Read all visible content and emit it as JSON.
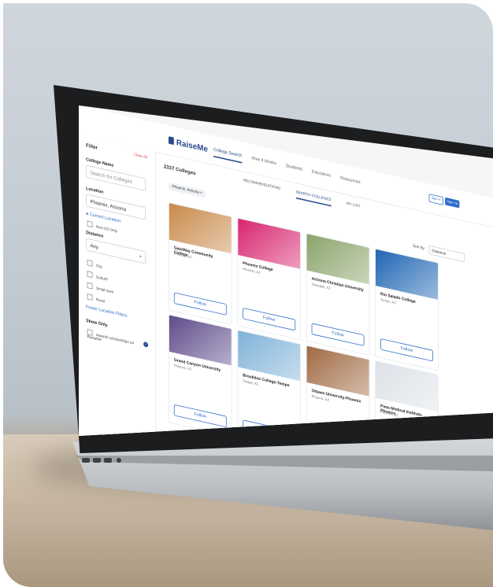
{
  "brand": {
    "name": "RaiseMe",
    "color": "#2a4b8d"
  },
  "nav": {
    "items": [
      "College Search",
      "How it Works",
      "Students",
      "Educators",
      "Resources"
    ],
    "signin": "Sign in",
    "signup": "Sign Up"
  },
  "sidebar": {
    "filter": "Filter",
    "clear": "Clear All",
    "college_name_label": "College Name",
    "college_name_placeholder": "Search for Colleges",
    "location_label": "Location",
    "location_value": "Phoenix, Arizona",
    "current_location": "Current Location",
    "non_us": "Non-US Only",
    "distance_label": "Distance",
    "distance_value": "Any",
    "types": [
      "City",
      "Suburb",
      "Small town",
      "Rural"
    ],
    "fewer": "Fewer Location Filters",
    "show_only": "Show Only",
    "awards": "Awards scholarships on RaiseMe"
  },
  "main": {
    "count": "2337 Colleges",
    "tabs": [
      "RECOMMENDATIONS",
      "SEARCH COLLEGES",
      "MY LIST"
    ],
    "chip": "Phoenix, Arizona ×",
    "sort_label": "Sort By",
    "sort_value": "Distance",
    "follow": "Follow",
    "colleges": [
      {
        "name": "GateWay Community College",
        "city": "Phoenix, AZ",
        "color": "#c98a4a"
      },
      {
        "name": "Phoenix College",
        "city": "Phoenix, AZ",
        "color": "#d8246f"
      },
      {
        "name": "Arizona Christian University",
        "city": "Glendale, AZ",
        "color": "#8aa36a"
      },
      {
        "name": "Rio Salado College",
        "city": "Tempe, AZ",
        "color": "#1f66b3"
      },
      {
        "name": "Grand Canyon University",
        "city": "Phoenix, AZ",
        "color": "#5e4b8a"
      },
      {
        "name": "Brookline College-Tempe",
        "city": "Tempe, AZ",
        "color": "#7fb3d8"
      },
      {
        "name": "Ottawa University-Phoenix",
        "city": "Phoenix, AZ",
        "color": "#a06a42"
      },
      {
        "name": "Pima Medical Institute-Phoenix",
        "city": "Phoenix, AZ",
        "color": "#dde2e8"
      }
    ]
  }
}
